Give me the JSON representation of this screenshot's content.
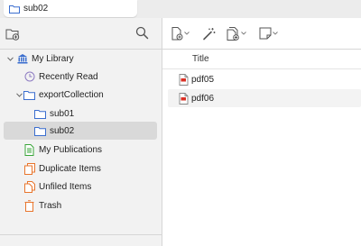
{
  "tab": {
    "label": "sub02"
  },
  "left_toolbar": {
    "new_collection_icon": "new-collection-icon",
    "search_icon": "search-icon"
  },
  "tree": {
    "items": [
      {
        "label": "My Library",
        "icon": "library-icon",
        "expanded": true
      },
      {
        "label": "Recently Read",
        "icon": "clock-icon"
      },
      {
        "label": "exportCollection",
        "icon": "folder-icon",
        "expanded": true
      },
      {
        "label": "sub01",
        "icon": "folder-icon"
      },
      {
        "label": "sub02",
        "icon": "folder-icon",
        "selected": true
      },
      {
        "label": "My Publications",
        "icon": "publications-icon"
      },
      {
        "label": "Duplicate Items",
        "icon": "duplicate-icon"
      },
      {
        "label": "Unfiled Items",
        "icon": "unfiled-icon"
      },
      {
        "label": "Trash",
        "icon": "trash-icon"
      }
    ]
  },
  "right_toolbar": {
    "buttons": [
      "new-item-icon",
      "magic-wand-icon",
      "add-attachment-icon",
      "new-note-icon"
    ]
  },
  "items_table": {
    "column_title": "Title",
    "rows": [
      {
        "title": "pdf05",
        "type": "pdf"
      },
      {
        "title": "pdf06",
        "type": "pdf"
      }
    ]
  },
  "colors": {
    "accent_blue": "#3b6ecf",
    "selection_bg": "#d9d9d9",
    "publications_green": "#3aa53a",
    "orange": "#e8752c",
    "pdf_red": "#d93025"
  }
}
